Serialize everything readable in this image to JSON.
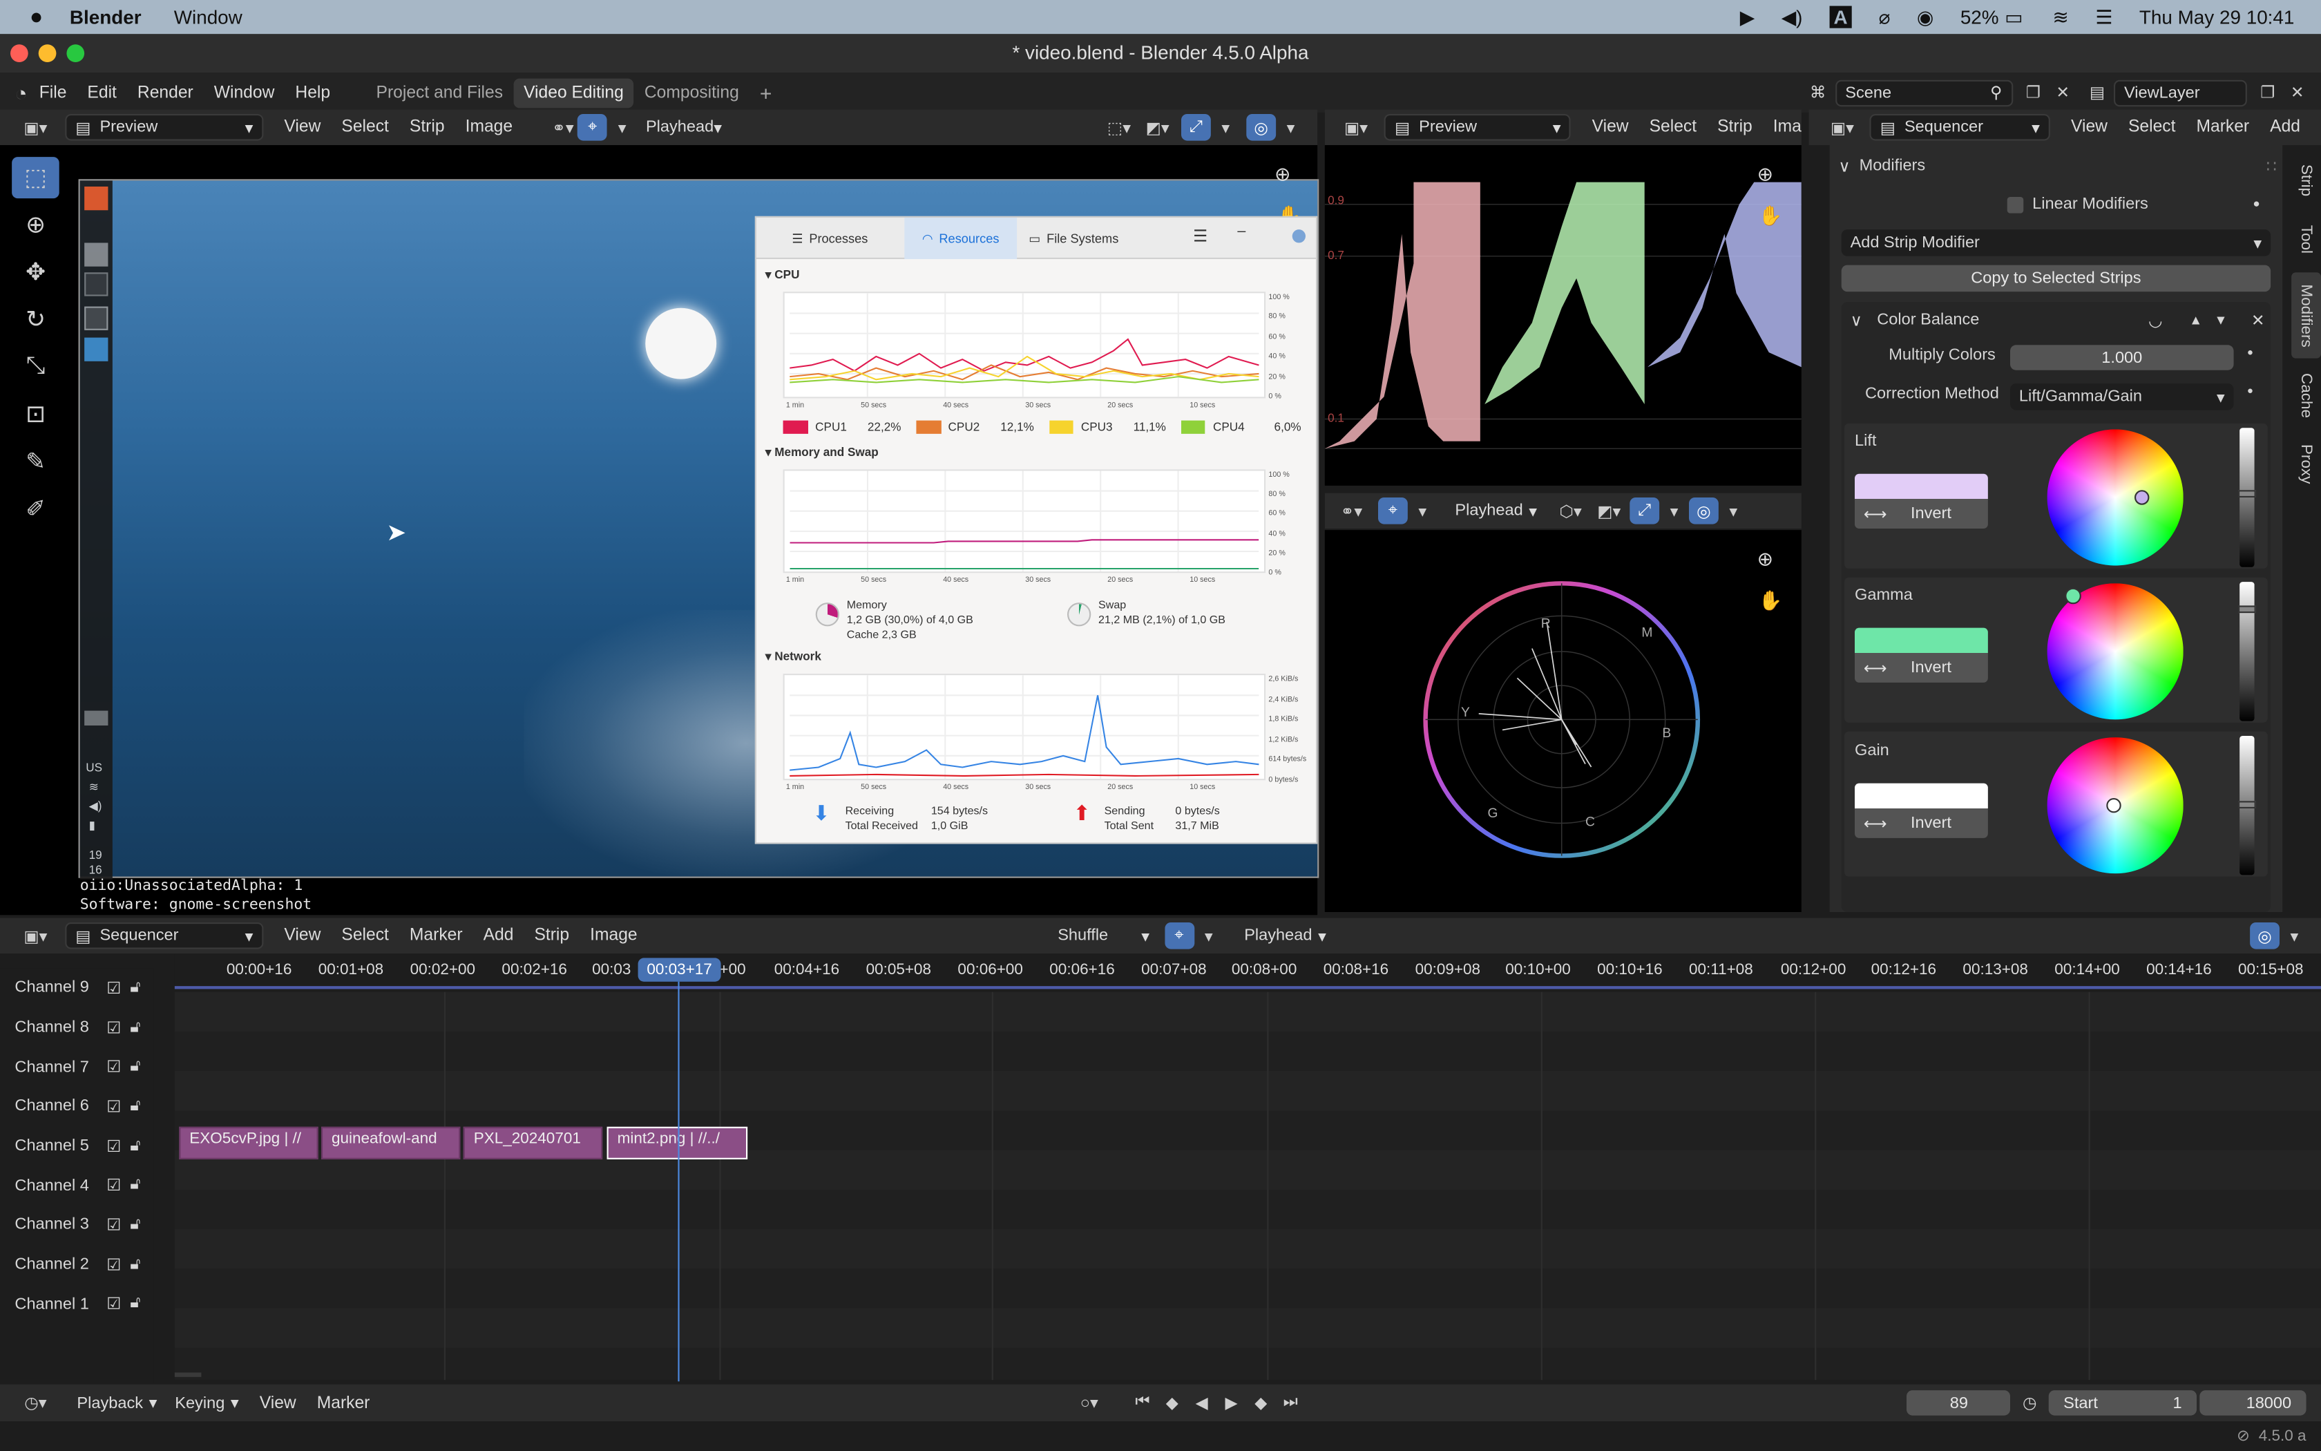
{
  "macbar": {
    "app": "Blender",
    "menu_window": "Window",
    "battery": "52%",
    "datetime": "Thu May 29  10:41"
  },
  "window": {
    "title": "* video.blend - Blender 4.5.0 Alpha"
  },
  "topbar": {
    "menus": [
      "File",
      "Edit",
      "Render",
      "Window",
      "Help"
    ],
    "workspaces": [
      "Project and Files",
      "Video Editing",
      "Compositing"
    ],
    "active_workspace": "Video Editing",
    "scene": "Scene",
    "viewlayer": "ViewLayer"
  },
  "preview1": {
    "editor": "Preview",
    "menus": [
      "View",
      "Select",
      "Strip",
      "Image"
    ],
    "playhead": "Playhead",
    "meta_line1": "oiio:UnassociatedAlpha: 1",
    "meta_line2": "Software: gnome-screenshot"
  },
  "sysmon": {
    "tabs": [
      "Processes",
      "Resources",
      "File Systems"
    ],
    "active_tab": "Resources",
    "cpu_title": "CPU",
    "cpus": [
      {
        "name": "CPU1",
        "val": "22,2%",
        "color": "#e01b50"
      },
      {
        "name": "CPU2",
        "val": "12,1%",
        "color": "#e57d33"
      },
      {
        "name": "CPU3",
        "val": "11,1%",
        "color": "#f6d32d"
      },
      {
        "name": "CPU4",
        "val": "6,0%",
        "color": "#8fd13a"
      }
    ],
    "mem_title": "Memory and Swap",
    "mem_label": "Memory",
    "mem_val": "1,2 GB (30,0%) of 4,0 GB",
    "mem_cache": "Cache 2,3 GB",
    "swap_label": "Swap",
    "swap_val": "21,2 MB (2,1%) of 1,0 GB",
    "net_title": "Network",
    "recv_label": "Receiving",
    "recv_val": "154 bytes/s",
    "recv_total_label": "Total Received",
    "recv_total": "1,0 GiB",
    "send_label": "Sending",
    "send_val": "0 bytes/s",
    "send_total_label": "Total Sent",
    "send_total": "31,7 MiB",
    "time_ticks": [
      "1 min",
      "50 secs",
      "40 secs",
      "30 secs",
      "20 secs",
      "10 secs"
    ],
    "pct_ticks": [
      "100 %",
      "80 %",
      "60 %",
      "40 %",
      "20 %",
      "0 %"
    ],
    "net_ticks": [
      "2,6 KiB/s",
      "2,4 KiB/s",
      "1,8 KiB/s",
      "1,2 KiB/s",
      "614 bytes/s",
      "0 bytes/s"
    ]
  },
  "taskbar": {
    "kbd": "US",
    "n1": "19",
    "n2": "16"
  },
  "preview2": {
    "editor": "Preview",
    "menus": [
      "View",
      "Select",
      "Strip",
      "Ima"
    ],
    "playhead": "Playhead",
    "scope_labels": [
      "R",
      "M",
      "B",
      "C",
      "G",
      "Y"
    ],
    "wave_labels": [
      "0.9",
      "0.7",
      "0.1"
    ]
  },
  "props": {
    "editor": "Sequencer",
    "menus": [
      "View",
      "Select",
      "Marker",
      "Add"
    ],
    "modifiers_title": "Modifiers",
    "linear": "Linear Modifiers",
    "add_mod": "Add Strip Modifier",
    "copy": "Copy to Selected Strips",
    "cb_title": "Color Balance",
    "mult_label": "Multiply Colors",
    "mult_val": "1.000",
    "corr_label": "Correction Method",
    "corr_val": "Lift/Gamma/Gain",
    "lift": "Lift",
    "gamma": "Gamma",
    "gain": "Gain",
    "invert": "Invert",
    "lift_color": "#e2cdf7",
    "gamma_color": "#6ee6a8",
    "gain_color": "#ffffff",
    "tabs": [
      "Strip",
      "Tool",
      "Modifiers",
      "Cache",
      "Proxy"
    ]
  },
  "seq": {
    "editor": "Sequencer",
    "menus": [
      "View",
      "Select",
      "Marker",
      "Add",
      "Strip",
      "Image"
    ],
    "shuffle": "Shuffle",
    "playhead": "Playhead",
    "current": "00:03+17",
    "ticks": [
      "00:00+16",
      "00:01+08",
      "00:02+00",
      "00:02+16",
      "00:03",
      "+00",
      "00:04+16",
      "00:05+08",
      "00:06+00",
      "00:06+16",
      "00:07+08",
      "00:08+00",
      "00:08+16",
      "00:09+08",
      "00:10+00",
      "00:10+16",
      "00:11+08",
      "00:12+00",
      "00:12+16",
      "00:13+08",
      "00:14+00",
      "00:14+16",
      "00:15+08"
    ],
    "channels": [
      "Channel 9",
      "Channel 8",
      "Channel 7",
      "Channel 6",
      "Channel 5",
      "Channel 4",
      "Channel 3",
      "Channel 2",
      "Channel 1"
    ],
    "strips": [
      "EXO5cvP.jpg | //",
      "guineafowl-and",
      "PXL_20240701",
      "mint2.png | //../"
    ]
  },
  "footer": {
    "menus": [
      "Playback",
      "Keying",
      "View",
      "Marker"
    ],
    "frame": "89",
    "start_label": "Start",
    "start": "1",
    "end": "18000",
    "version": "4.5.0 a"
  }
}
